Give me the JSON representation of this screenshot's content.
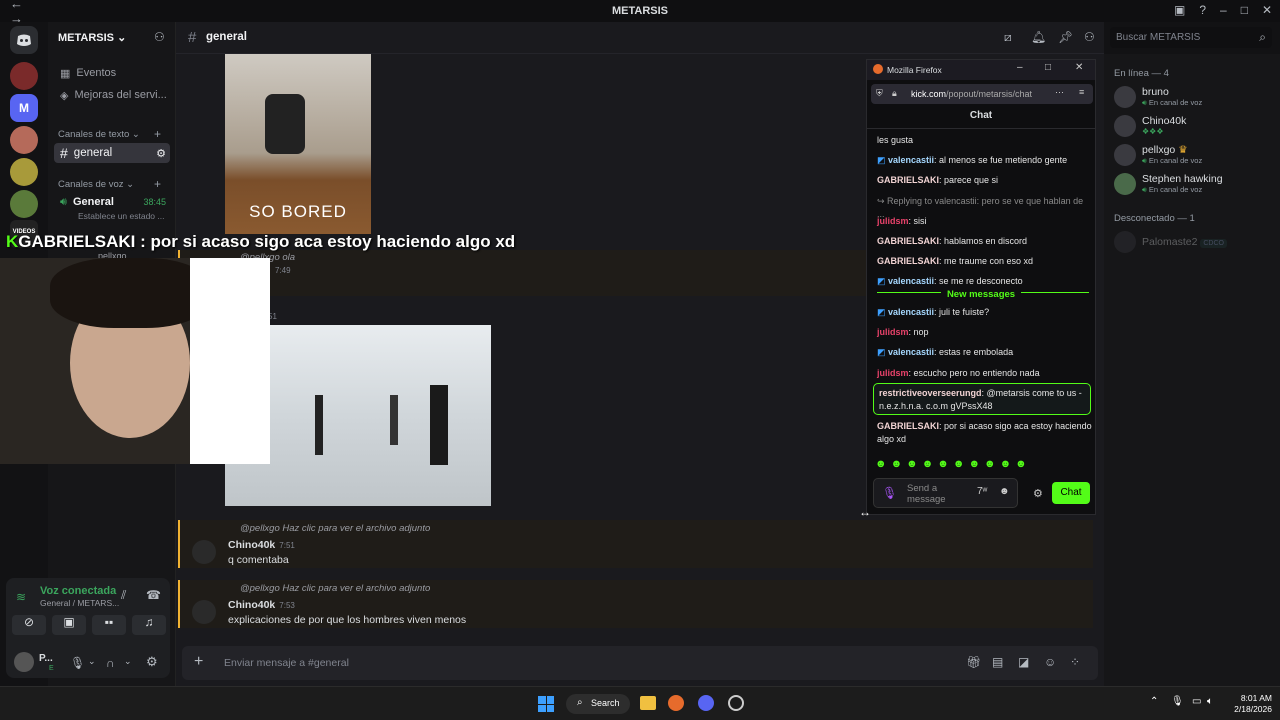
{
  "window": {
    "title": "METARSIS"
  },
  "server": {
    "name": "METARSIS"
  },
  "sidebar": {
    "events": "Eventos",
    "improvements": "Mejoras del servi...",
    "text_category": "Canales de texto",
    "text_channel": "general",
    "voice_category": "Canales de voz",
    "voice_channel": "General",
    "voice_timer": "38:45",
    "status_hint": "Establece un estado ...",
    "voice_user": "pellxgo",
    "rail_badge": "VIDEOS"
  },
  "voice_panel": {
    "title": "Voz conectada",
    "subtitle": "General / METARS...",
    "user": "P...",
    "user_status": "E"
  },
  "header": {
    "channel": "general",
    "search_placeholder": "Buscar METARSIS"
  },
  "messages": {
    "gif_caption": "SO BORED",
    "m1_reply": "@pellxgo ola",
    "m1_time": "7:49",
    "m2_time": "51",
    "m3_reply": "@pellxgo Haz clic para ver el archivo adjunto",
    "m3_author": "Chino40k",
    "m3_time": "7:51",
    "m3_text": "q comentaba",
    "m4_reply": "@pellxgo Haz clic para ver el archivo adjunto",
    "m4_author": "Chino40k",
    "m4_time": "7:53",
    "m4_text": "explicaciones de por que los hombres viven menos"
  },
  "composer": {
    "placeholder": "Enviar mensaje a #general"
  },
  "members": {
    "online_header": "En línea — 4",
    "online": [
      {
        "name": "bruno",
        "status": "En canal de voz"
      },
      {
        "name": "Chino40k",
        "status": ""
      },
      {
        "name": "pellxgo",
        "status": "En canal de voz"
      },
      {
        "name": "Stephen hawking",
        "status": "En canal de voz"
      }
    ],
    "offline_header": "Desconectado — 1",
    "offline": [
      {
        "name": "Palomaste2",
        "tag": "CDCO"
      }
    ]
  },
  "overlay": {
    "text": "GABRIELSAKI : por si acaso sigo aca estoy haciendo algo xd"
  },
  "firefox": {
    "title": "Mozilla Firefox",
    "url_host": "kick.com",
    "url_path": "/popout/metarsis/chat",
    "chat_title": "Chat",
    "lines": [
      {
        "user": "",
        "text": "les gusta",
        "color": "#e6e6e6"
      },
      {
        "user": "valencastii",
        "text": ": al menos se fue metiendo gente",
        "color": "#a6d8ff",
        "badge": true
      },
      {
        "user": "GABRIELSAKI",
        "text": ": parece que si",
        "color": "#f2d4d4"
      },
      {
        "user": "",
        "text": "↪ Replying to valencastii: pero se ve que hablan de ...",
        "color": "#8a8a8a"
      },
      {
        "user": "julidsm",
        "text": ": sisi",
        "color": "#e8426a"
      },
      {
        "user": "GABRIELSAKI",
        "text": ": hablamos en discord",
        "color": "#f2d4d4"
      },
      {
        "user": "GABRIELSAKI",
        "text": ": me traume con eso xd",
        "color": "#f2d4d4"
      },
      {
        "user": "valencastii",
        "text": ": se me re desconecto",
        "color": "#a6d8ff",
        "badge": true
      }
    ],
    "new_messages": "New messages",
    "lines2": [
      {
        "user": "valencastii",
        "text": ": juli te fuiste?",
        "color": "#a6d8ff",
        "badge": true
      },
      {
        "user": "julidsm",
        "text": ": nop",
        "color": "#e8426a"
      },
      {
        "user": "valencastii",
        "text": ": estas re embolada",
        "color": "#a6d8ff",
        "badge": true
      },
      {
        "user": "julidsm",
        "text": ": escucho pero no entiendo nada",
        "color": "#e8426a"
      }
    ],
    "highlight_user": "restrictiveoverseerungd",
    "highlight_text": ": @metarsis come to us - n.e.z.h.n.a. c.o.m gVPssX48",
    "last_user": "GABRIELSAKI",
    "last_text": ": por si acaso sigo aca estoy haciendo algo xd",
    "send_placeholder": "Send a message",
    "chat_button": "Chat"
  },
  "taskbar": {
    "search": "Search",
    "time": "8:01 AM",
    "date": "2/18/2026"
  },
  "colors": {
    "accent": "#53fc18",
    "discord_blurple": "#5865f2",
    "reply_bar": "#f0b232"
  }
}
